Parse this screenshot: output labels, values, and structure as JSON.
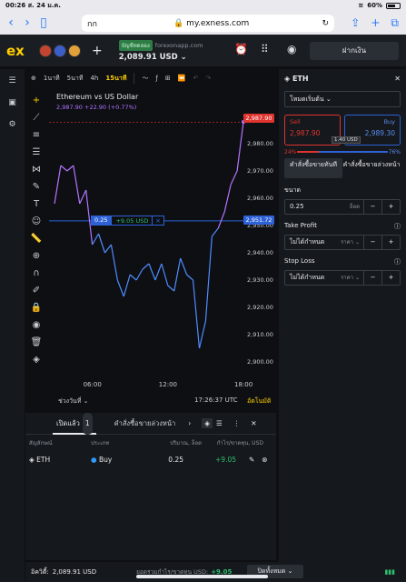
{
  "status": {
    "time": "00:26",
    "date": "ส. 24 ม.ค.",
    "battery": "60%"
  },
  "safari": {
    "tab_label": "กก",
    "url": "my.exness.com"
  },
  "header": {
    "logo": "ex",
    "account_badge": "บัญชีทดลอง",
    "server": "forexonapp.com",
    "balance": "2,089.91 USD",
    "deposit_label": "ฝากเงิน"
  },
  "toolbar": {
    "timeframes": [
      "1นาที",
      "5นาที",
      "4h",
      "15นาที"
    ],
    "active_timeframe": "15นาที"
  },
  "chart": {
    "title": "Ethereum vs US Dollar",
    "subtitle": "2,987.90 +22.90 (+0.77%)",
    "range_label": "ช่วงวันที่ ⌄",
    "clock": "17:26:37 UTC",
    "auto_label": "อัตโนมัติ",
    "current_price_tag": "2,987.90",
    "position_price_tag": "2,951.72",
    "position_volume": "0.25",
    "position_pl": "+9.05 USD",
    "colors": {
      "line_blue": "#4f8cff",
      "line_purple": "#b374ff",
      "sell": "#e0342f",
      "buy": "#2d61d6"
    }
  },
  "chart_data": {
    "type": "line",
    "title": "Ethereum vs US Dollar",
    "xlabel": "",
    "ylabel": "",
    "x_ticks": [
      "06:00",
      "12:00",
      "18:00"
    ],
    "y_ticks": [
      2990,
      2980,
      2970,
      2960,
      2950,
      2940,
      2930,
      2920,
      2910,
      2900
    ],
    "ylim": [
      2896,
      2992
    ],
    "x": [
      "03:00",
      "03:30",
      "04:00",
      "04:30",
      "05:00",
      "05:30",
      "06:00",
      "06:30",
      "07:00",
      "07:30",
      "08:00",
      "08:30",
      "09:00",
      "09:30",
      "10:00",
      "10:30",
      "11:00",
      "11:30",
      "12:00",
      "12:30",
      "13:00",
      "13:30",
      "14:00",
      "14:30",
      "15:00",
      "15:30",
      "16:00",
      "16:30",
      "17:00",
      "17:30",
      "18:00"
    ],
    "values": [
      2958,
      2972,
      2970,
      2972,
      2958,
      2963,
      2943,
      2947,
      2940,
      2943,
      2930,
      2924,
      2932,
      2930,
      2934,
      2936,
      2930,
      2936,
      2928,
      2926,
      2938,
      2932,
      2930,
      2905,
      2915,
      2946,
      2949,
      2955,
      2965,
      2970,
      2988
    ],
    "grid": false
  },
  "panel": {
    "symbol": "ETH",
    "mode": "โหมดเริ่มต้น",
    "sell_label": "Sell",
    "sell_price": "2,987.90",
    "buy_label": "Buy",
    "buy_price": "2,989.30",
    "spread": "1.40 USD",
    "sell_pct": "24%",
    "buy_pct": "76%",
    "tab_market": "คำสั่งซื้อขายทันที",
    "tab_pending": "คำสั่งซื้อขายล่วงหน้า",
    "size_label": "ขนาด",
    "size_value": "0.25",
    "size_unit": "ล็อต",
    "tp_label": "Take Profit",
    "tp_value": "ไม่ได้กำหนด",
    "tp_unit": "ราคา ⌄",
    "sl_label": "Stop Loss",
    "sl_value": "ไม่ได้กำหนด",
    "sl_unit": "ราคา ⌄"
  },
  "positions": {
    "tab_open": "เปิดแล้ว",
    "open_count": "1",
    "tab_pending": "คำสั่งซื้อขายล่วงหน้า",
    "col_symbol": "สัญลักษณ์",
    "col_type": "ประเภท",
    "col_volume": "ปริมาณ, ล็อต",
    "col_pl": "กำไร/ขาดทุน, USD",
    "row": {
      "symbol": "ETH",
      "type": "Buy",
      "volume": "0.25",
      "pl": "+9.05"
    }
  },
  "footer": {
    "equity_label": "อิควิตี้:",
    "equity_value": "2,089.91 USD",
    "total_label": "ยอดรวมกำไร/ขาดทุน USD:",
    "total_value": "+9.05",
    "close_all": "ปิดทั้งหมด ⌄"
  }
}
